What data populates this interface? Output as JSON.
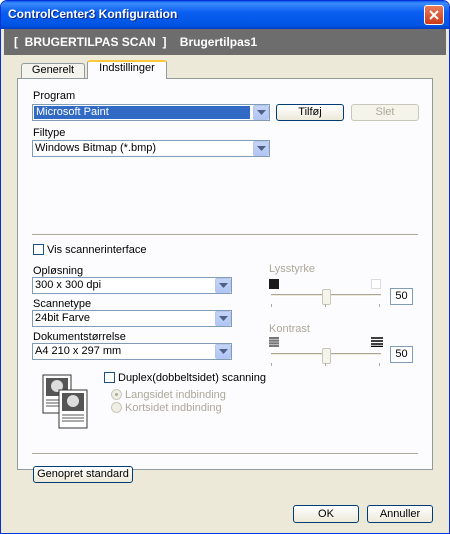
{
  "window": {
    "title": "ControlCenter3 Konfiguration"
  },
  "header": {
    "text": "[  BRUGERTILPAS SCAN  ]    Brugertilpas1"
  },
  "tabs": [
    {
      "label": "Generelt",
      "active": false
    },
    {
      "label": "Indstillinger",
      "active": true
    }
  ],
  "program": {
    "label": "Program",
    "value": "Microsoft Paint",
    "add_button": "Tilføj",
    "delete_button": "Slet"
  },
  "filetype": {
    "label": "Filtype",
    "value": "Windows Bitmap (*.bmp)"
  },
  "scanner_interface": {
    "label": "Vis scannerinterface",
    "checked": false
  },
  "resolution": {
    "label": "Opløsning",
    "value": "300 x 300 dpi"
  },
  "scantype": {
    "label": "Scannetype",
    "value": "24bit Farve"
  },
  "docsize": {
    "label": "Dokumentstørrelse",
    "value": "A4 210 x 297 mm"
  },
  "brightness": {
    "label": "Lysstyrke",
    "value": "50",
    "level": 0.5
  },
  "contrast": {
    "label": "Kontrast",
    "value": "50",
    "level": 0.5
  },
  "duplex": {
    "label": "Duplex(dobbeltsidet) scanning",
    "checked": false,
    "options": [
      "Langsidet indbinding",
      "Kortsidet indbinding"
    ]
  },
  "restore_button": "Genopret standard",
  "footer": {
    "ok": "OK",
    "cancel": "Annuller"
  },
  "colors": {
    "title_blue": "#0054e3",
    "selection": "#316ac5",
    "header_gray": "#6d6d6d",
    "tab_highlight": "#ffc83c"
  },
  "icons": [
    "close-icon",
    "dropdown-arrow-icon",
    "duplex-document-icon",
    "brightness-low-icon",
    "brightness-high-icon",
    "contrast-low-icon",
    "contrast-high-icon"
  ]
}
